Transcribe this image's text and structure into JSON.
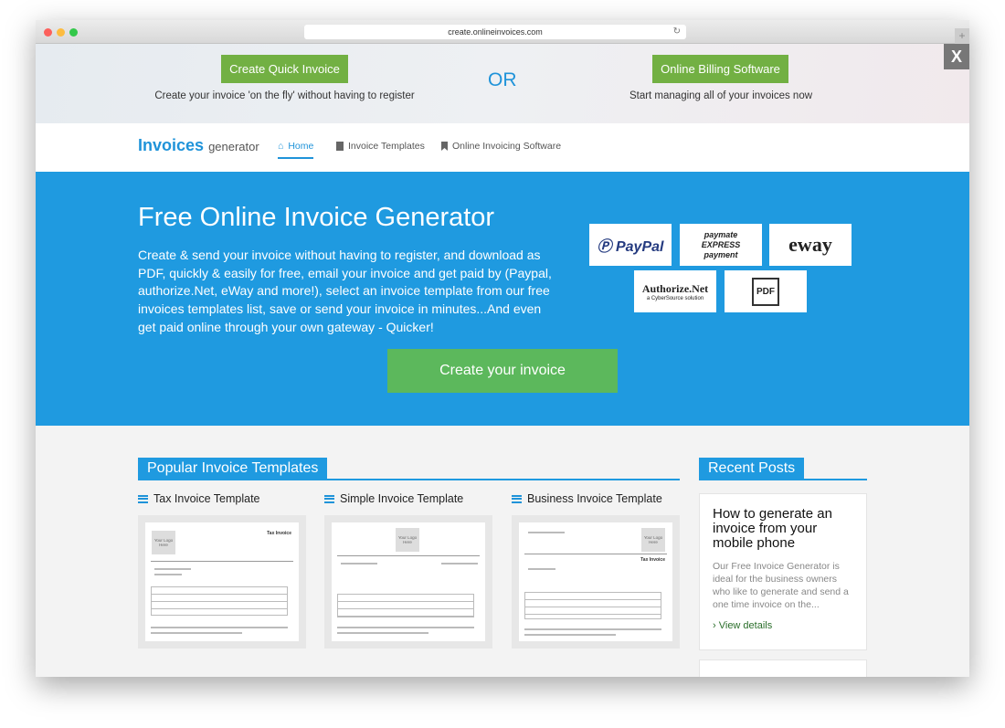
{
  "browser": {
    "url": "create.onlineinvoices.com",
    "colors": {
      "close": "#fc605c",
      "min": "#fdbc40",
      "max": "#34c84a"
    }
  },
  "promo": {
    "left_button": "Create Quick Invoice",
    "left_text": "Create your invoice 'on the fly' without having to register",
    "or": "OR",
    "right_button": "Online Billing Software",
    "right_text": "Start managing all of your invoices now",
    "close": "X"
  },
  "nav": {
    "logo_main": "Invoices",
    "logo_sub": "generator",
    "items": [
      {
        "label": "Home",
        "icon": "home-icon"
      },
      {
        "label": "Invoice Templates",
        "icon": "file-icon"
      },
      {
        "label": "Online Invoicing Software",
        "icon": "bookmark-icon"
      }
    ]
  },
  "hero": {
    "title": "Free Online Invoice Generator",
    "text": "Create & send your invoice without having to register, and download as PDF, quickly & easily for free, email your invoice and get paid by (Paypal, authorize.Net, eWay and more!), select an invoice template from our free invoices templates list, save or send your invoice in minutes...And even get paid online through your own gateway - Quicker!",
    "cta": "Create your invoice",
    "payments": [
      "PayPal",
      "paymate EXPRESS payment",
      "eway",
      "Authorize.Net",
      "a CyberSource solution",
      "PDF"
    ]
  },
  "templates": {
    "title": "Popular Invoice Templates",
    "items": [
      {
        "name": "Tax Invoice Template",
        "doc_title": "Tax Invoice"
      },
      {
        "name": "Simple Invoice Template",
        "doc_title": ""
      },
      {
        "name": "Business Invoice Template",
        "doc_title": "Tax Invoice"
      }
    ],
    "logo_placeholder": "Your Logo Here"
  },
  "recent": {
    "title": "Recent Posts",
    "posts": [
      {
        "title": "How to generate an invoice from your mobile phone",
        "excerpt": "Our Free Invoice Generator is ideal for the business owners who like to generate and send a one time invoice on the...",
        "link": "View details"
      }
    ]
  },
  "colors": {
    "brand_blue": "#1f9ae0",
    "promo_green": "#72b043",
    "cta_green": "#5cb85c"
  }
}
